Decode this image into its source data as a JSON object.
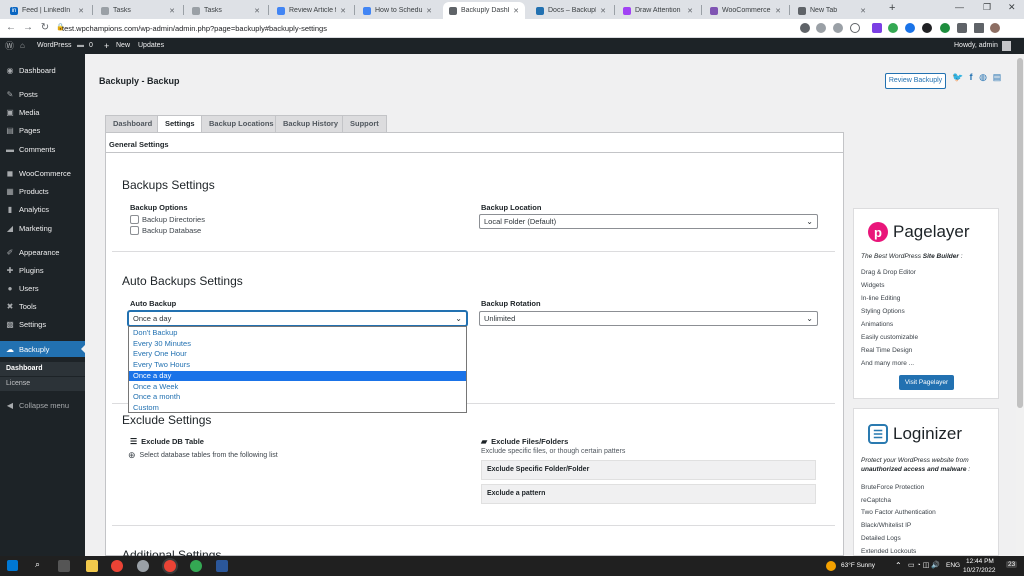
{
  "browser": {
    "tabs": [
      {
        "title": "Feed | LinkedIn",
        "favicon_color": "#0a66c2",
        "glyph": "in"
      },
      {
        "title": "Tasks",
        "favicon_color": "#9aa0a6",
        "glyph": ""
      },
      {
        "title": "Tasks",
        "favicon_color": "#9aa0a6",
        "glyph": ""
      },
      {
        "title": "Review Article for",
        "favicon_color": "#4285f4",
        "glyph": ""
      },
      {
        "title": "How to Schedule",
        "favicon_color": "#4285f4",
        "glyph": ""
      },
      {
        "title": "Backuply Dashbo",
        "favicon_color": "#5f6368",
        "glyph": ""
      },
      {
        "title": "Docs – Backuply",
        "favicon_color": "#2271b1",
        "glyph": ""
      },
      {
        "title": "Draw Attention | ",
        "favicon_color": "#a142f4",
        "glyph": ""
      },
      {
        "title": "WooCommerce P",
        "favicon_color": "#7f54b3",
        "glyph": ""
      },
      {
        "title": "New Tab",
        "favicon_color": "#5f6368",
        "glyph": ""
      }
    ],
    "new_tab": "+",
    "url": "test.wpchampions.com/wp-admin/admin.php?page=backuply#backuply-settings"
  },
  "adminbar": {
    "site": "WordPress",
    "comments_count": "0",
    "new_label": "New",
    "updates_label": "Updates",
    "howdy": "Howdy, admin"
  },
  "sidebar": {
    "items": [
      {
        "label": "Dashboard",
        "icon": "dashboard-icon",
        "glyph": "◉"
      },
      {
        "label": "Posts",
        "icon": "pin-icon",
        "glyph": "✎"
      },
      {
        "label": "Media",
        "icon": "media-icon",
        "glyph": "▣"
      },
      {
        "label": "Pages",
        "icon": "pages-icon",
        "glyph": "▤"
      },
      {
        "label": "Comments",
        "icon": "comment-icon",
        "glyph": "▬"
      },
      {
        "label": "WooCommerce",
        "icon": "woo-icon",
        "glyph": "◼"
      },
      {
        "label": "Products",
        "icon": "products-icon",
        "glyph": "▦"
      },
      {
        "label": "Analytics",
        "icon": "analytics-icon",
        "glyph": "▮"
      },
      {
        "label": "Marketing",
        "icon": "megaphone-icon",
        "glyph": "◢"
      },
      {
        "label": "Appearance",
        "icon": "brush-icon",
        "glyph": "✐"
      },
      {
        "label": "Plugins",
        "icon": "plugin-icon",
        "glyph": "✚"
      },
      {
        "label": "Users",
        "icon": "user-icon",
        "glyph": "●"
      },
      {
        "label": "Tools",
        "icon": "wrench-icon",
        "glyph": "✖"
      },
      {
        "label": "Settings",
        "icon": "settings-icon",
        "glyph": "▩"
      },
      {
        "label": "Backuply",
        "icon": "cloud-icon",
        "glyph": "☁"
      }
    ],
    "submenu": [
      "Dashboard",
      "License"
    ],
    "collapse": "Collapse menu"
  },
  "page": {
    "title": "Backuply - Backup",
    "review_button": "Review Backuply",
    "tabs": [
      "Dashboard",
      "Settings",
      "Backup Locations",
      "Backup History",
      "Support"
    ],
    "active_tab": "Settings",
    "general_settings": "General Settings",
    "backups_settings": {
      "heading": "Backups Settings",
      "options_label": "Backup Options",
      "checkboxes": [
        "Backup Directories",
        "Backup Database"
      ],
      "location_label": "Backup Location",
      "location_value": "Local Folder (Default)"
    },
    "auto_backups": {
      "heading": "Auto Backups Settings",
      "auto_label": "Auto Backup",
      "auto_value": "Once a day",
      "rotation_label": "Backup Rotation",
      "rotation_value": "Unlimited",
      "options": [
        "Don't Backup",
        "Every 30 Minutes",
        "Every One Hour",
        "Every Two Hours",
        "Once a day",
        "Once a Week",
        "Once a month",
        "Custom"
      ],
      "selected_option": "Once a day"
    },
    "exclude": {
      "heading": "Exclude Settings",
      "db_label": "Exclude DB Table",
      "db_hint": "Select database tables from the following list",
      "files_label": "Exclude Files/Folders",
      "files_hint": "Exclude specific files, or though certain patters",
      "boxes": [
        "Exclude Specific Folder/Folder",
        "Exclude a pattern"
      ]
    },
    "additional_heading": "Additional Settings"
  },
  "promo": {
    "pagelayer": {
      "name": "Pagelayer",
      "tagline_a": "The Best WordPress ",
      "tagline_b": "Site Builder",
      "tagline_c": " :",
      "features": [
        "Drag & Drop Editor",
        "Widgets",
        "In-line Editing",
        "Styling Options",
        "Animations",
        "Easily customizable",
        "Real Time Design",
        "And many more ..."
      ],
      "button": "Visit Pagelayer"
    },
    "loginizer": {
      "name": "Loginizer",
      "tagline_a": "Protect your WordPress website from ",
      "tagline_b": "unauthorized access and malware",
      "tagline_c": " :",
      "features": [
        "BruteForce Protection",
        "reCaptcha",
        "Two Factor Authentication",
        "Black/Whitelist IP",
        "Detailed Logs",
        "Extended Lockouts"
      ]
    }
  },
  "taskbar": {
    "weather": "63°F  Sunny",
    "lang": "ENG",
    "time": "12:44 PM",
    "date": "10/27/2022",
    "notif": "23"
  },
  "colors": {
    "wp_blue": "#2271b1",
    "admin_dark": "#1d2327",
    "pagelayer_pink": "#e9157a",
    "loginizer_blue": "#2a7ab0"
  }
}
